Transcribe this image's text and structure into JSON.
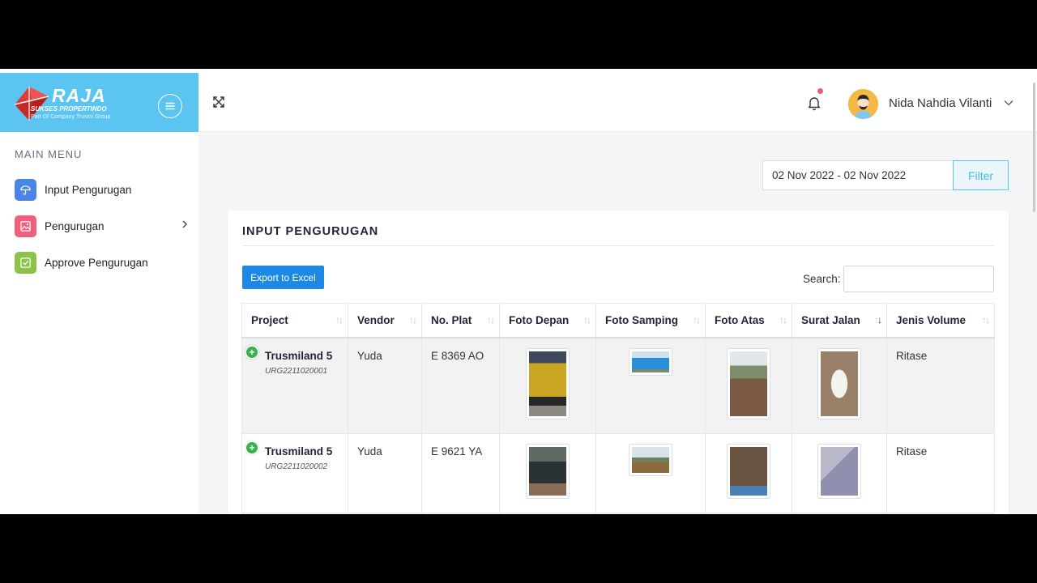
{
  "brand": {
    "name": "RAJA",
    "tagline": "SUKSES PROPERTINDO",
    "subtitle": "Part Of Company Trusmi Group"
  },
  "sidebar": {
    "title": "MAIN MENU",
    "items": [
      {
        "label": "Input Pengurugan",
        "icon": "umbrella-icon",
        "color": "#4a84e8"
      },
      {
        "label": "Pengurugan",
        "icon": "image-icon",
        "color": "#f0607e",
        "has_submenu": true
      },
      {
        "label": "Approve Pengurugan",
        "icon": "check-square-icon",
        "color": "#8bc34a"
      }
    ]
  },
  "header": {
    "user_name": "Nida Nahdia Vilanti",
    "notification_dot_color": "#f15a6b"
  },
  "filter": {
    "date_range": "02 Nov 2022 - 02 Nov 2022",
    "button_label": "Filter"
  },
  "card": {
    "title": "INPUT PENGURUGAN",
    "export_label": "Export to Excel",
    "search_label": "Search:",
    "search_value": ""
  },
  "table": {
    "columns": [
      "Project",
      "Vendor",
      "No. Plat",
      "Foto Depan",
      "Foto Samping",
      "Foto Atas",
      "Surat Jalan",
      "Jenis Volume"
    ],
    "sorted_column": "Surat Jalan",
    "rows": [
      {
        "project": "Trusmiland 5",
        "code": "URG2211020001",
        "vendor": "Yuda",
        "plat": "E 8369 AO",
        "jenis_volume": "Ritase"
      },
      {
        "project": "Trusmiland 5",
        "code": "URG2211020002",
        "vendor": "Yuda",
        "plat": "E 9621 YA",
        "jenis_volume": "Ritase"
      }
    ]
  },
  "colors": {
    "brand_blue": "#5bc4f1",
    "export_blue": "#1e88e5",
    "expand_green": "#37b24d"
  }
}
